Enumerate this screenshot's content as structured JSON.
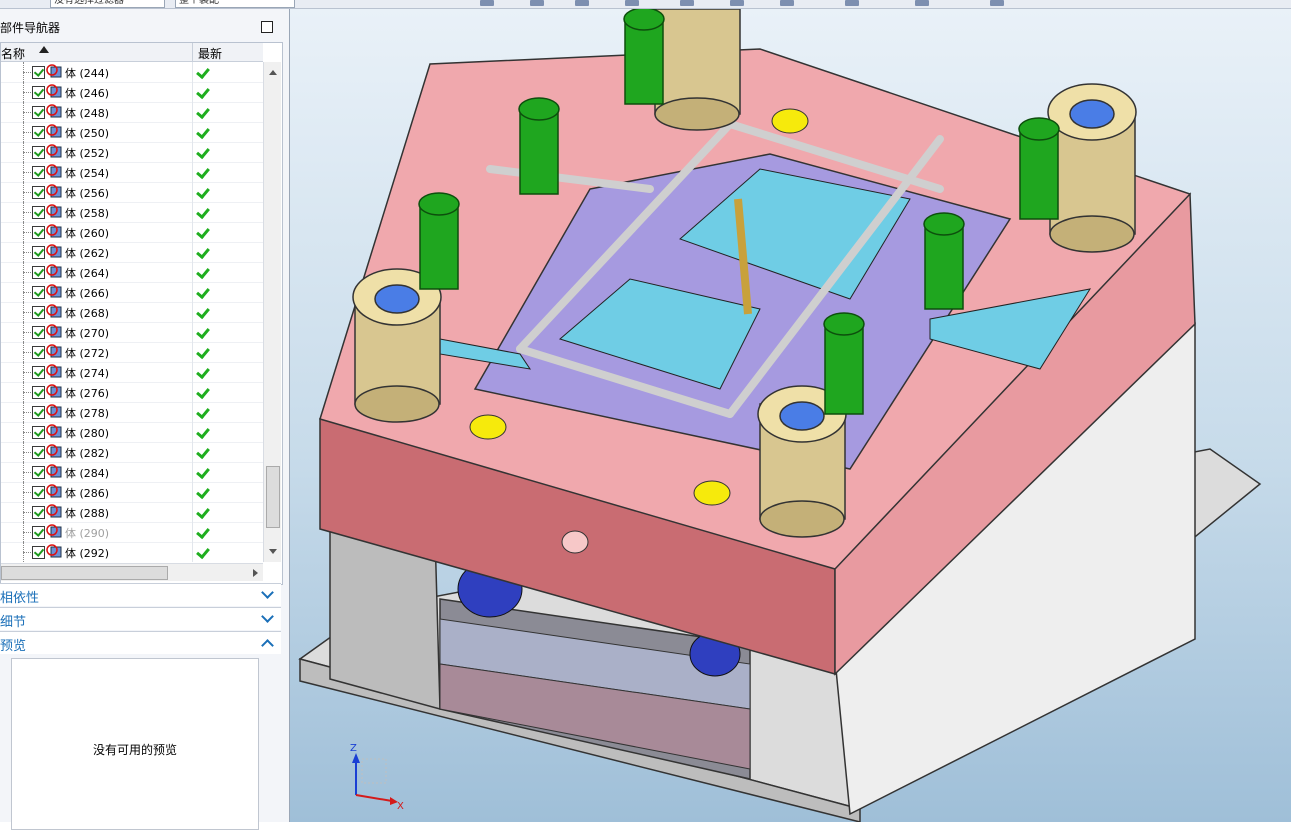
{
  "toolbar": {
    "field1": "没有选择过滤器",
    "field2": "整个装配"
  },
  "navigator": {
    "title": "部件导航器",
    "col_name": "名称",
    "col_latest": "最新",
    "rows": [
      {
        "label": "体 (244)",
        "dim": false
      },
      {
        "label": "体 (246)",
        "dim": false
      },
      {
        "label": "体 (248)",
        "dim": false
      },
      {
        "label": "体 (250)",
        "dim": false
      },
      {
        "label": "体 (252)",
        "dim": false
      },
      {
        "label": "体 (254)",
        "dim": false
      },
      {
        "label": "体 (256)",
        "dim": false
      },
      {
        "label": "体 (258)",
        "dim": false
      },
      {
        "label": "体 (260)",
        "dim": false
      },
      {
        "label": "体 (262)",
        "dim": false
      },
      {
        "label": "体 (264)",
        "dim": false
      },
      {
        "label": "体 (266)",
        "dim": false
      },
      {
        "label": "体 (268)",
        "dim": false
      },
      {
        "label": "体 (270)",
        "dim": false
      },
      {
        "label": "体 (272)",
        "dim": false
      },
      {
        "label": "体 (274)",
        "dim": false
      },
      {
        "label": "体 (276)",
        "dim": false
      },
      {
        "label": "体 (278)",
        "dim": false
      },
      {
        "label": "体 (280)",
        "dim": false
      },
      {
        "label": "体 (282)",
        "dim": false
      },
      {
        "label": "体 (284)",
        "dim": false
      },
      {
        "label": "体 (286)",
        "dim": false
      },
      {
        "label": "体 (288)",
        "dim": false
      },
      {
        "label": "体 (290)",
        "dim": true
      },
      {
        "label": "体 (292)",
        "dim": false
      }
    ]
  },
  "sections": {
    "dependency": "相依性",
    "details": "细节",
    "preview": "预览",
    "preview_empty": "没有可用的预览"
  },
  "triad": {
    "z": "Z",
    "x": "X"
  },
  "colors": {
    "plate_pink": "#f0a8ad",
    "plate_red": "#c96c72",
    "guide_green": "#1fa61f",
    "bushing_tan": "#d8c690",
    "cavity_purple": "#a69ae0",
    "insert_cyan": "#6fcde5",
    "marker_yellow": "#f6ea0c",
    "frame_gray": "#d6d6d6"
  }
}
